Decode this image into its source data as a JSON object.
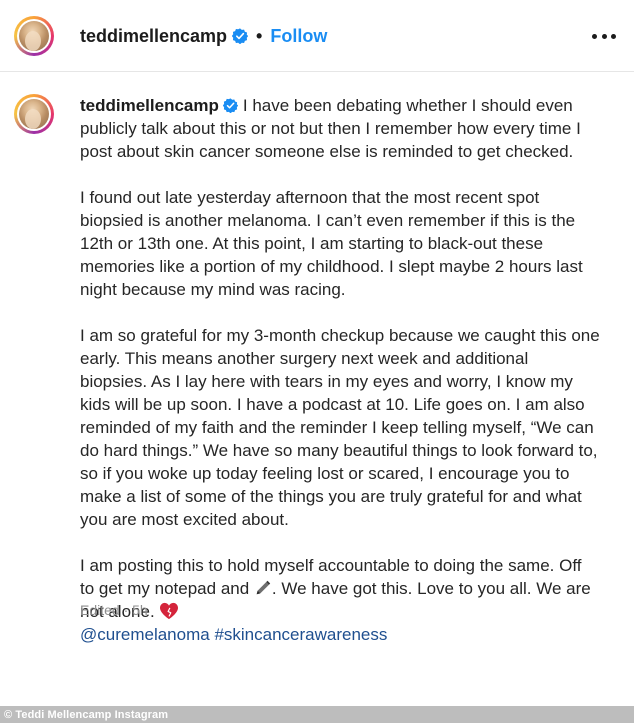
{
  "header": {
    "username": "teddimellencamp",
    "separator": "•",
    "follow_label": "Follow"
  },
  "post": {
    "username": "teddimellencamp",
    "paragraphs": [
      "I have been debating whether I should even publicly talk about this or not but then I remember how every time I post about skin cancer someone else is reminded to get checked.",
      "I found out late yesterday afternoon that the most recent spot biopsied is another melanoma. I can’t even remember if this is the 12th or 13th one. At this point, I am starting to black-out these memories like a portion of my childhood. I slept maybe 2 hours last night because my mind was racing.",
      "I am so grateful for my 3-month checkup because we caught this one early. This means another surgery next week and additional biopsies. As I lay here with tears in my eyes and worry, I know my kids will be up soon. I have a podcast at 10. Life goes on. I am also reminded of my faith and the reminder I keep telling myself, “We can do hard things.” We have so many beautiful things to look forward to, so if you woke up today feeling lost or scared, I encourage you to make a list of some of the things you are truly grateful for and what you are most excited about."
    ],
    "final_part1": "I am posting this to hold myself accountable to doing the same. Off to get my notepad and",
    "final_part2": ". We have got this. Love to you all. We are not alone.",
    "hashtag1": "@curemelanoma",
    "hashtag2": "#skincancerawareness",
    "edited": "Edited · 5h"
  },
  "credit": "© Teddi Mellencamp Instagram",
  "colors": {
    "link": "#1a8df3",
    "verified": "#1a8df3",
    "heart": "#d4243b"
  },
  "icons": {
    "verified": "verified-badge-icon",
    "more": "more-options-icon",
    "pen": "pen-icon",
    "heart": "heart-icon"
  }
}
